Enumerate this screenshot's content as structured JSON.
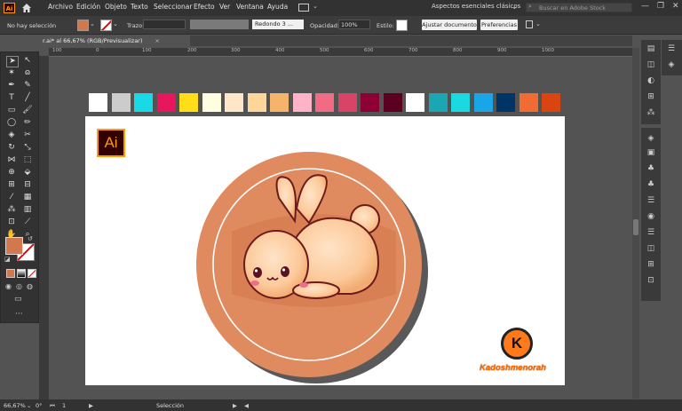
{
  "app": {
    "logo": "Ai"
  },
  "menu": [
    "Archivo",
    "Edición",
    "Objeto",
    "Texto",
    "Seleccionar",
    "Efecto",
    "Ver",
    "Ventana",
    "Ayuda"
  ],
  "workspace": "Aspectos esenciales clásicos",
  "stock_search": {
    "placeholder": "Buscar en Adobe Stock"
  },
  "controlbar": {
    "selection": "No hay selección",
    "stroke_label": "Trazo:",
    "brush": "Redondo 3 ...",
    "opacity_label": "Opacidad:",
    "opacity_value": "100%",
    "style_label": "Estilo:",
    "doc_settings": "Ajustar documento",
    "prefs": "Preferencias"
  },
  "tab": {
    "label": "r.ai* al 66,67% (RGB/Previsualizar)"
  },
  "ruler": [
    "100",
    "0",
    "100",
    "200",
    "300",
    "400",
    "500",
    "600",
    "700",
    "800",
    "900",
    "1000"
  ],
  "swatches": [
    "#ffffff",
    "#cccccc",
    "#1ad9e6",
    "#e6175c",
    "#ffdd17",
    "#ffffe0",
    "#ffe6c7",
    "#ffd699",
    "#f5b36b",
    "#ffb3c6",
    "#f26b85",
    "#d94466",
    "#8c0033",
    "#5c0022",
    "#ffffff",
    "#1aa6b3",
    "#1ad9e0",
    "#1aa6e6",
    "#003366",
    "#f26b33",
    "#d94411"
  ],
  "colors": {
    "fill": "#d2784f",
    "circle": "#e08a5f",
    "accent": "#ff9a00"
  },
  "artboard": {
    "brand": "Kadoshmenorah",
    "k": "K",
    "ai": "Ai"
  },
  "status": {
    "zoom": "66,67%",
    "angle": "0°",
    "page": "1",
    "tool": "Selección"
  }
}
